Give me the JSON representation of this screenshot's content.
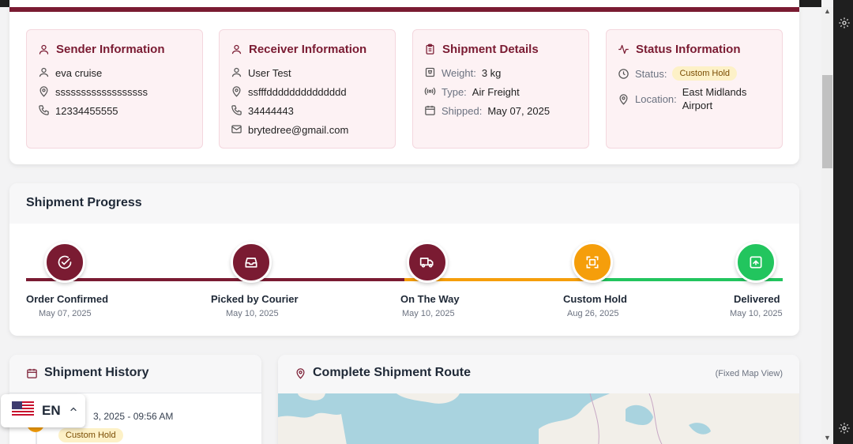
{
  "sender": {
    "title": "Sender Information",
    "name": "eva cruise",
    "address": "ssssssssssssssssss",
    "phone": "12334455555"
  },
  "receiver": {
    "title": "Receiver Information",
    "name": "User Test",
    "address": "ssfffdddddddddddddd",
    "phone": "34444443",
    "email": "brytedree@gmail.com"
  },
  "shipment": {
    "title": "Shipment Details",
    "weight_label": "Weight:",
    "weight": "3 kg",
    "type_label": "Type:",
    "type": "Air Freight",
    "shipped_label": "Shipped:",
    "shipped": "May 07, 2025"
  },
  "status": {
    "title": "Status Information",
    "status_label": "Status:",
    "status": "Custom Hold",
    "location_label": "Location:",
    "location": "East Midlands Airport"
  },
  "progress": {
    "title": "Shipment Progress",
    "steps": [
      {
        "label": "Order Confirmed",
        "date": "May 07, 2025",
        "color": "#7a1b32",
        "icon": "check-circle-icon"
      },
      {
        "label": "Picked by Courier",
        "date": "May 10, 2025",
        "color": "#7a1b32",
        "icon": "inbox-icon"
      },
      {
        "label": "On The Way",
        "date": "May 10, 2025",
        "color": "#7a1b32",
        "icon": "truck-icon"
      },
      {
        "label": "Custom Hold",
        "date": "Aug 26, 2025",
        "color": "#f59e0b",
        "icon": "scan-icon"
      },
      {
        "label": "Delivered",
        "date": "May 10, 2025",
        "color": "#22c55e",
        "icon": "package-icon"
      }
    ]
  },
  "history": {
    "title": "Shipment History",
    "time": "3, 2025 - 09:56 AM",
    "badge": "Custom Hold"
  },
  "route": {
    "title": "Complete Shipment Route",
    "note": "(Fixed Map View)"
  },
  "language": {
    "code": "EN"
  },
  "colors": {
    "brand": "#7a1b32",
    "hold": "#f59e0b",
    "delivered": "#22c55e"
  }
}
